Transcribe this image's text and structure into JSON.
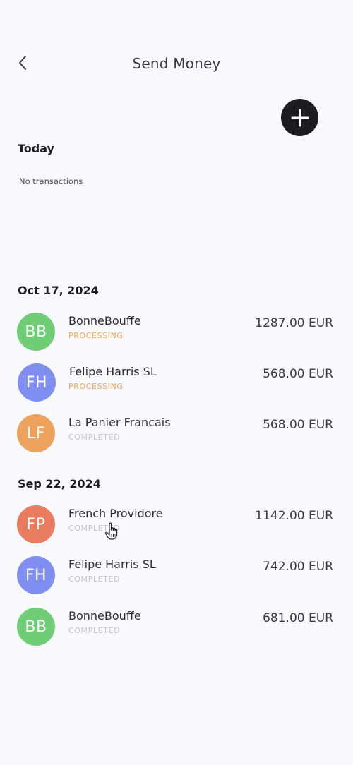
{
  "header": {
    "title": "Send Money"
  },
  "sections": [
    {
      "title": "Today",
      "empty_text": "No transactions",
      "transactions": []
    },
    {
      "title": "Oct 17, 2024",
      "transactions": [
        {
          "initials": "BB",
          "name": "BonneBouffe",
          "status": "PROCESSING",
          "amount": "1287.00 EUR",
          "avatar_color": "#6fcd75"
        },
        {
          "initials": "FH",
          "name": "Felipe Harris SL",
          "status": "PROCESSING",
          "amount": "568.00 EUR",
          "avatar_color": "#7f8ef0"
        },
        {
          "initials": "LF",
          "name": "La Panier Francais",
          "status": "COMPLETED",
          "amount": "568.00 EUR",
          "avatar_color": "#eda35d"
        }
      ]
    },
    {
      "title": "Sep 22, 2024",
      "transactions": [
        {
          "initials": "FP",
          "name": "French Providore",
          "status": "COMPLETED",
          "amount": "1142.00 EUR",
          "avatar_color": "#e97b5e"
        },
        {
          "initials": "FH",
          "name": "Felipe Harris SL",
          "status": "COMPLETED",
          "amount": "742.00 EUR",
          "avatar_color": "#7f8ef0"
        },
        {
          "initials": "BB",
          "name": "BonneBouffe",
          "status": "COMPLETED",
          "amount": "681.00 EUR",
          "avatar_color": "#6fcd75"
        }
      ]
    }
  ],
  "colors": {
    "processing": "#f0a65a",
    "completed": "#c4c6cf",
    "background": "#f8f9fc",
    "add_button": "#1c1c22"
  },
  "icons": {
    "back": "chevron-left-icon",
    "add": "plus-icon",
    "cursor": "hand-pointer-icon"
  }
}
